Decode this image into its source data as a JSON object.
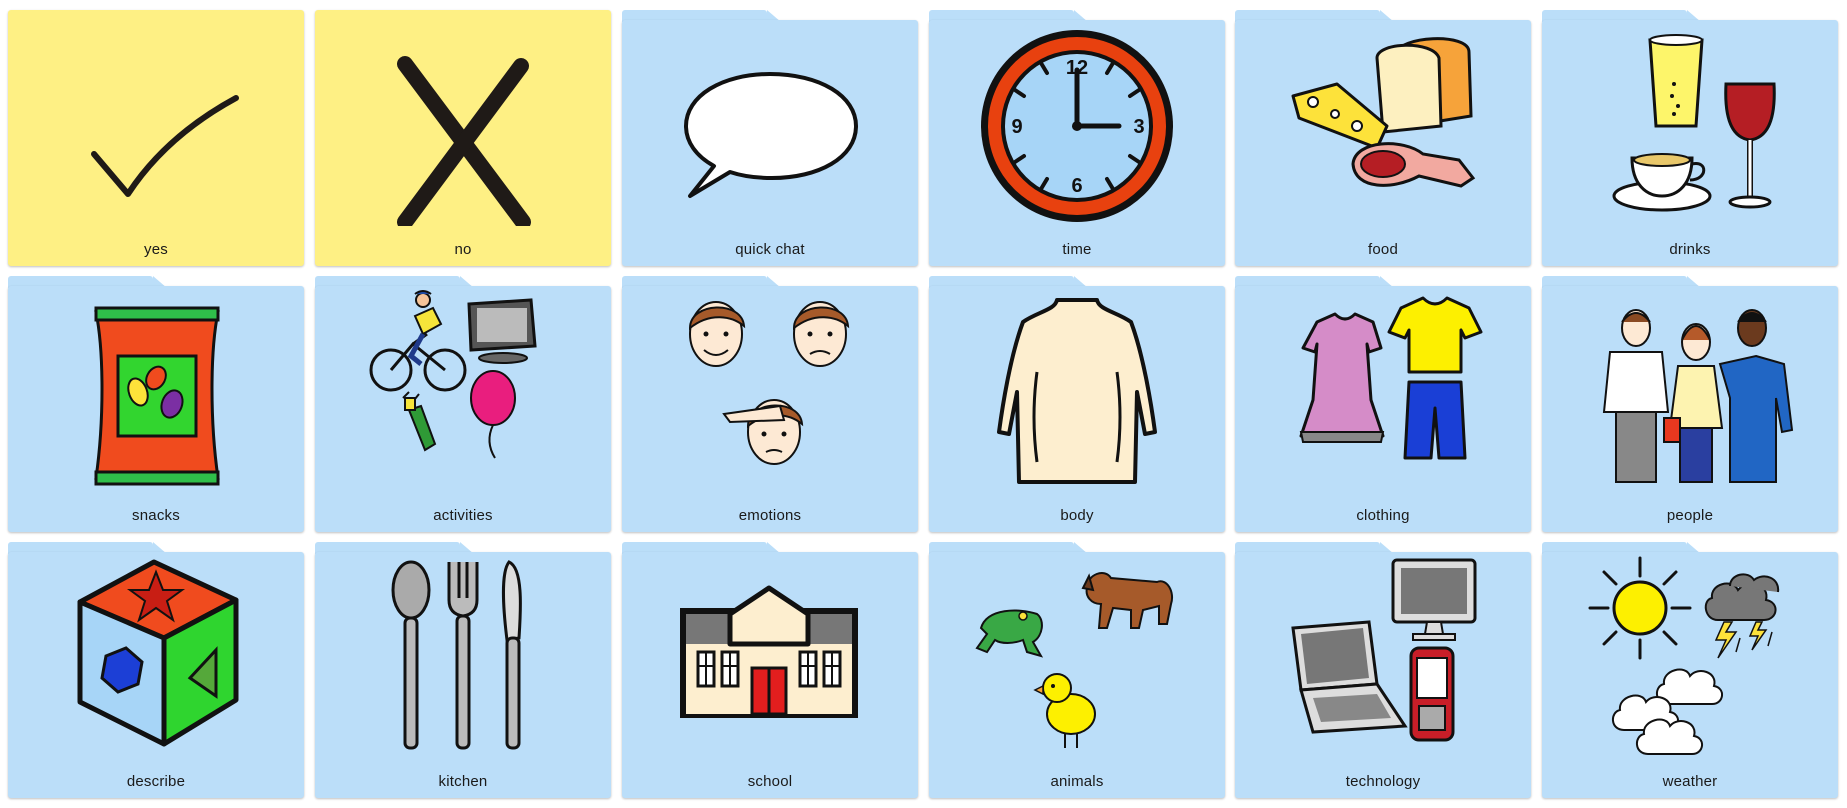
{
  "colors": {
    "yes_no_tile": "#fef084",
    "folder_tile": "#bbdef9",
    "label_text": "#1a1a1a"
  },
  "tiles": [
    {
      "label": "yes",
      "icon": "checkmark-icon",
      "kind": "button"
    },
    {
      "label": "no",
      "icon": "x-mark-icon",
      "kind": "button"
    },
    {
      "label": "quick chat",
      "icon": "speech-bubble-icon",
      "kind": "folder"
    },
    {
      "label": "time",
      "icon": "clock-icon",
      "kind": "folder",
      "clock_numbers": [
        "12",
        "3",
        "6",
        "9"
      ]
    },
    {
      "label": "food",
      "icon": "food-icon",
      "kind": "folder"
    },
    {
      "label": "drinks",
      "icon": "drinks-icon",
      "kind": "folder"
    },
    {
      "label": "snacks",
      "icon": "snacks-icon",
      "kind": "folder"
    },
    {
      "label": "activities",
      "icon": "activities-icon",
      "kind": "folder"
    },
    {
      "label": "emotions",
      "icon": "emotions-icon",
      "kind": "folder"
    },
    {
      "label": "body",
      "icon": "body-icon",
      "kind": "folder"
    },
    {
      "label": "clothing",
      "icon": "clothing-icon",
      "kind": "folder"
    },
    {
      "label": "people",
      "icon": "people-icon",
      "kind": "folder"
    },
    {
      "label": "describe",
      "icon": "shape-cube-icon",
      "kind": "folder"
    },
    {
      "label": "kitchen",
      "icon": "cutlery-icon",
      "kind": "folder"
    },
    {
      "label": "school",
      "icon": "school-building-icon",
      "kind": "folder"
    },
    {
      "label": "animals",
      "icon": "animals-icon",
      "kind": "folder"
    },
    {
      "label": "technology",
      "icon": "technology-icon",
      "kind": "folder"
    },
    {
      "label": "weather",
      "icon": "weather-icon",
      "kind": "folder"
    }
  ]
}
